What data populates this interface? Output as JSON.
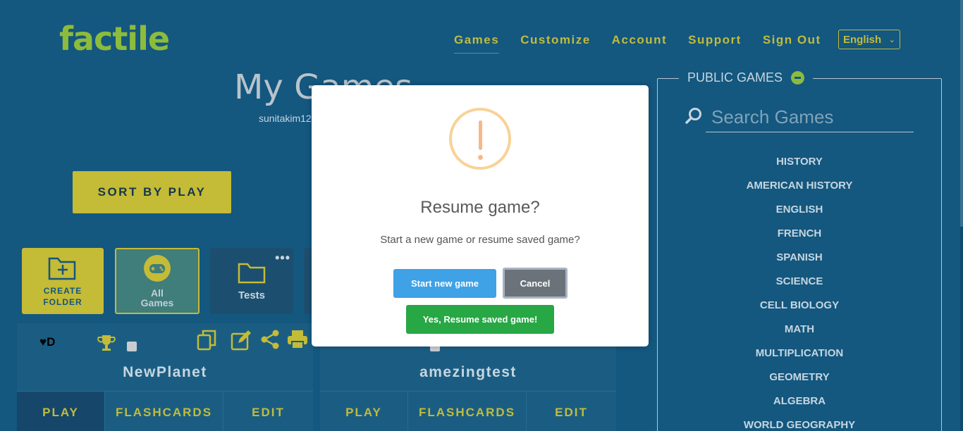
{
  "brand": {
    "logo": "factile"
  },
  "nav": {
    "items": [
      {
        "label": "Games",
        "active": true
      },
      {
        "label": "Customize"
      },
      {
        "label": "Account"
      },
      {
        "label": "Support"
      },
      {
        "label": "Sign Out"
      }
    ],
    "language": "English"
  },
  "main": {
    "title": "My Games",
    "username": "sunitakim12",
    "sort_button": "SORT BY PLAY",
    "tiles": {
      "create_folder": "CREATE\nFOLDER",
      "all_games": "All Games",
      "tests": "Tests"
    },
    "cards": [
      {
        "name": "NewPlanet",
        "play": "PLAY",
        "flashcards": "FLASHCARDS",
        "edit": "EDIT",
        "heart_label": "♥D"
      },
      {
        "name": "amezingtest",
        "play": "PLAY",
        "flashcards": "FLASHCARDS",
        "edit": "EDIT"
      }
    ]
  },
  "public_games": {
    "title": "PUBLIC GAMES",
    "search_placeholder": "Search Games",
    "categories": [
      "HISTORY",
      "AMERICAN HISTORY",
      "ENGLISH",
      "FRENCH",
      "SPANISH",
      "SCIENCE",
      "CELL BIOLOGY",
      "MATH",
      "MULTIPLICATION",
      "GEOMETRY",
      "ALGEBRA",
      "WORLD GEOGRAPHY"
    ]
  },
  "modal": {
    "title": "Resume game?",
    "text": "Start a new game or resume saved game?",
    "start_new": "Start new game",
    "cancel": "Cancel",
    "resume": "Yes, Resume saved game!"
  },
  "colors": {
    "background": "#14577f",
    "accent_yellow": "#c4bb36",
    "logo_green": "#8dbb3c",
    "btn_blue": "#3fa1e6",
    "btn_gray": "#6b727a",
    "btn_green": "#28a745"
  }
}
